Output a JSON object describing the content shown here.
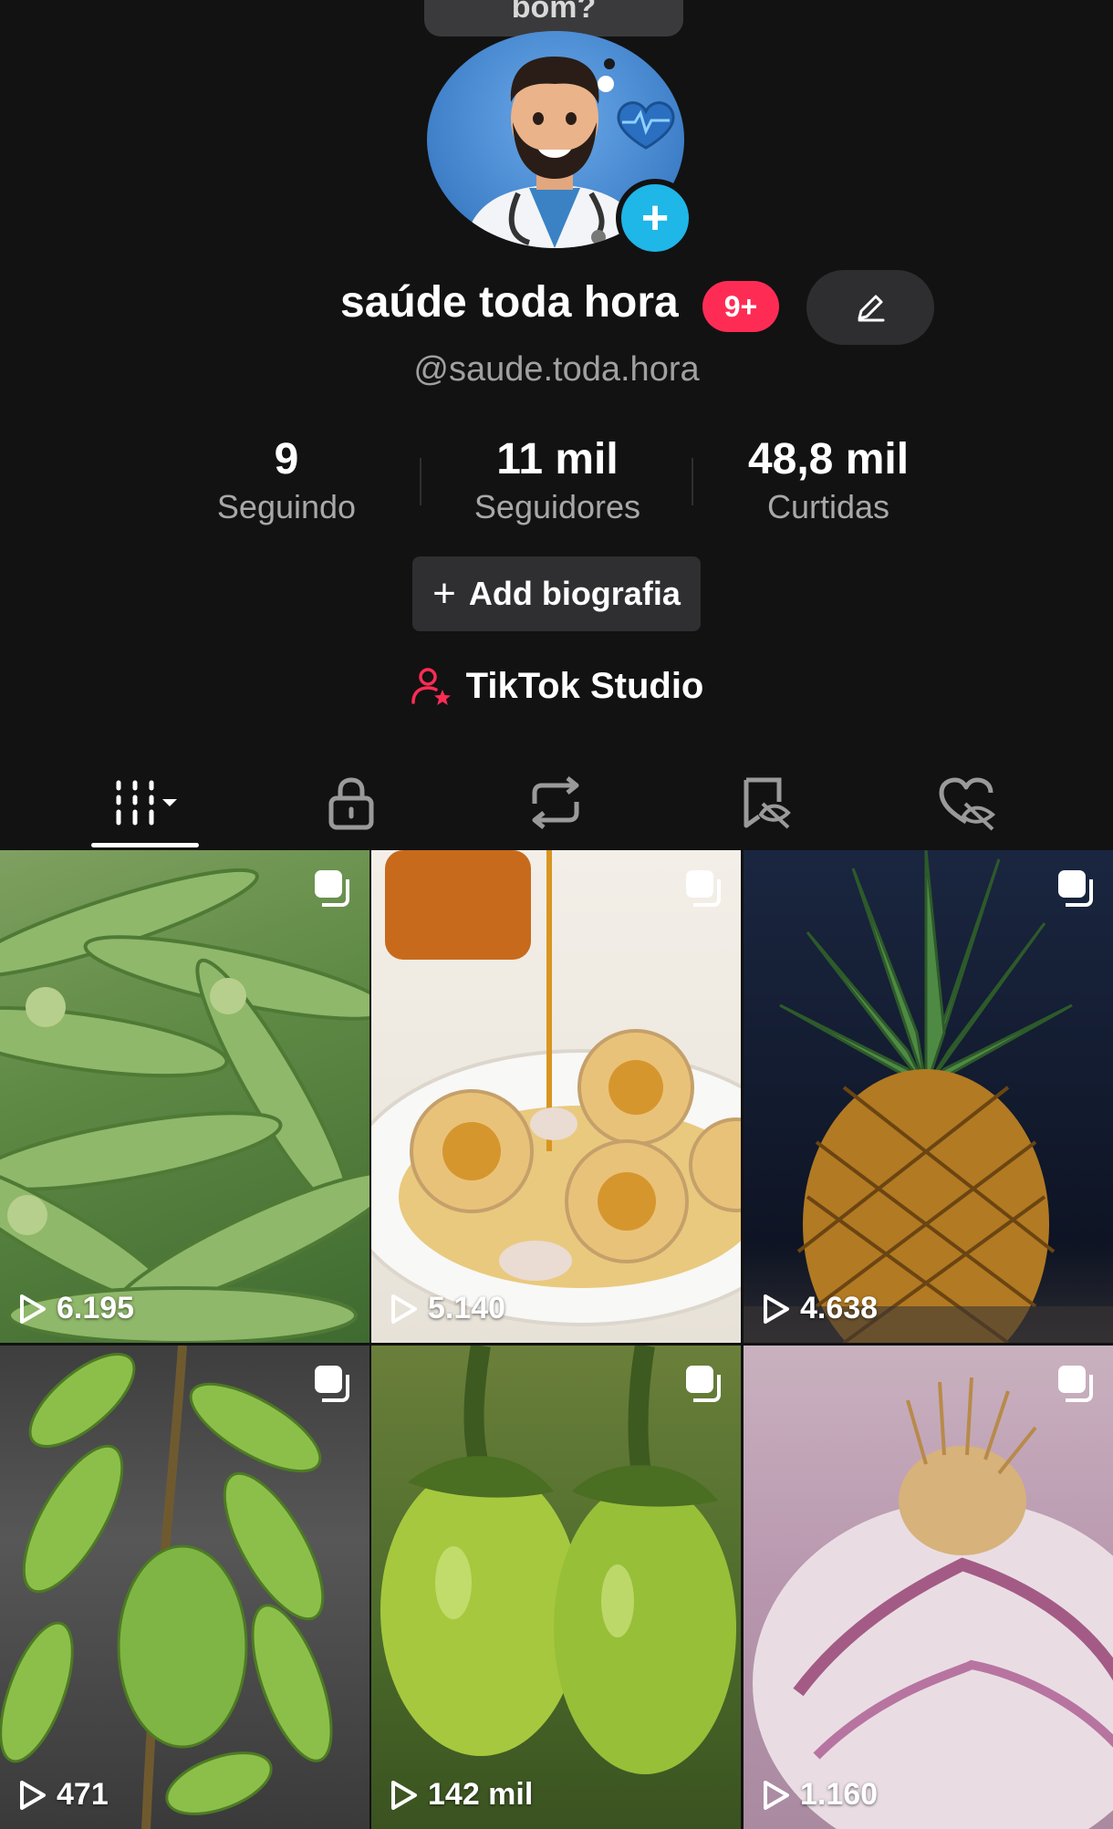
{
  "profile": {
    "bubble_text": "bom?",
    "display_name": "saúde toda hora",
    "notification_badge": "9+",
    "handle": "@saude.toda.hora",
    "stats": [
      {
        "value": "9",
        "label": "Seguindo"
      },
      {
        "value": "11 mil",
        "label": "Seguidores"
      },
      {
        "value": "48,8 mil",
        "label": "Curtidas"
      }
    ],
    "add_bio_label": "Add biografia",
    "studio_label": "TikTok Studio"
  },
  "tabs": [
    {
      "icon": "videos-grid-icon",
      "active": true
    },
    {
      "icon": "lock-icon",
      "active": false
    },
    {
      "icon": "repost-icon",
      "active": false
    },
    {
      "icon": "favorites-icon",
      "active": false
    },
    {
      "icon": "liked-icon",
      "active": false
    }
  ],
  "videos": [
    {
      "views": "6.195",
      "subject": "okra"
    },
    {
      "views": "5.140",
      "subject": "garlic-honey"
    },
    {
      "views": "4.638",
      "subject": "pineapple"
    },
    {
      "views": "471",
      "subject": "leafy-plant"
    },
    {
      "views": "142 mil",
      "subject": "eggplants"
    },
    {
      "views": "1.160",
      "subject": "garlic-bulb"
    }
  ],
  "colors": {
    "background": "#121212",
    "accent": "#fe2c55",
    "avatar_add": "#1fb6e8"
  }
}
